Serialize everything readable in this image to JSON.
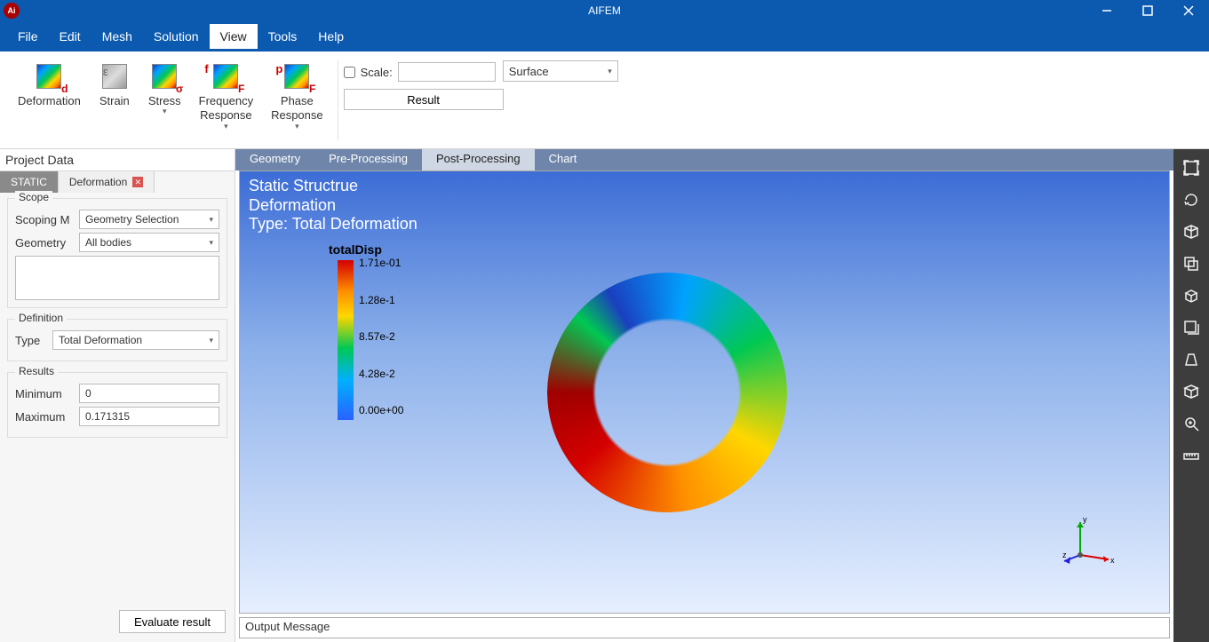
{
  "app": {
    "title": "AIFEM"
  },
  "window_controls": {
    "min": "minimize",
    "max": "maximize",
    "close": "close"
  },
  "menu": {
    "items": [
      "File",
      "Edit",
      "Mesh",
      "Solution",
      "View",
      "Tools",
      "Help"
    ],
    "active": "View"
  },
  "ribbon": {
    "deformation": "Deformation",
    "strain": "Strain",
    "stress": "Stress",
    "freq": "Frequency\nResponse",
    "phase": "Phase\nResponse",
    "scale_label": "Scale:",
    "scale_value": "",
    "result_btn": "Result",
    "rendermode": {
      "value": "Surface"
    },
    "sub_d": "d",
    "sub_e": "ε",
    "sub_s": "σ",
    "sub_f": "F",
    "sub_p": "F",
    "pre_f": "f",
    "pre_p": "p"
  },
  "project_panel": {
    "title": "Project Data",
    "tabs": {
      "static": "STATIC",
      "deformation": "Deformation"
    },
    "scope": {
      "legend": "Scope",
      "scoping_label": "Scoping M",
      "scoping_value": "Geometry Selection",
      "geometry_label": "Geometry",
      "geometry_value": "All bodies"
    },
    "definition": {
      "legend": "Definition",
      "type_label": "Type",
      "type_value": "Total Deformation"
    },
    "results": {
      "legend": "Results",
      "min_label": "Minimum",
      "min_value": "0",
      "max_label": "Maximum",
      "max_value": "0.171315"
    },
    "evaluate_btn": "Evaluate result"
  },
  "center": {
    "tabs": {
      "geometry": "Geometry",
      "prepro": "Pre-Processing",
      "postpro": "Post-Processing",
      "chart": "Chart"
    },
    "heading_line1": "Static Structrue",
    "heading_line2": "Deformation",
    "heading_line3": "Type: Total Deformation",
    "colorbar": {
      "title": "totalDisp",
      "labels": [
        "1.71e-01",
        "1.28e-1",
        "8.57e-2",
        "4.28e-2",
        "0.00e+00"
      ]
    },
    "axis": {
      "x": "x",
      "y": "y",
      "z": "z"
    },
    "output_msg": "Output Message"
  },
  "right_tools": [
    "frame",
    "refresh",
    "iso",
    "ortho",
    "cube",
    "pages",
    "persp",
    "box3d",
    "zoom",
    "ruler"
  ]
}
